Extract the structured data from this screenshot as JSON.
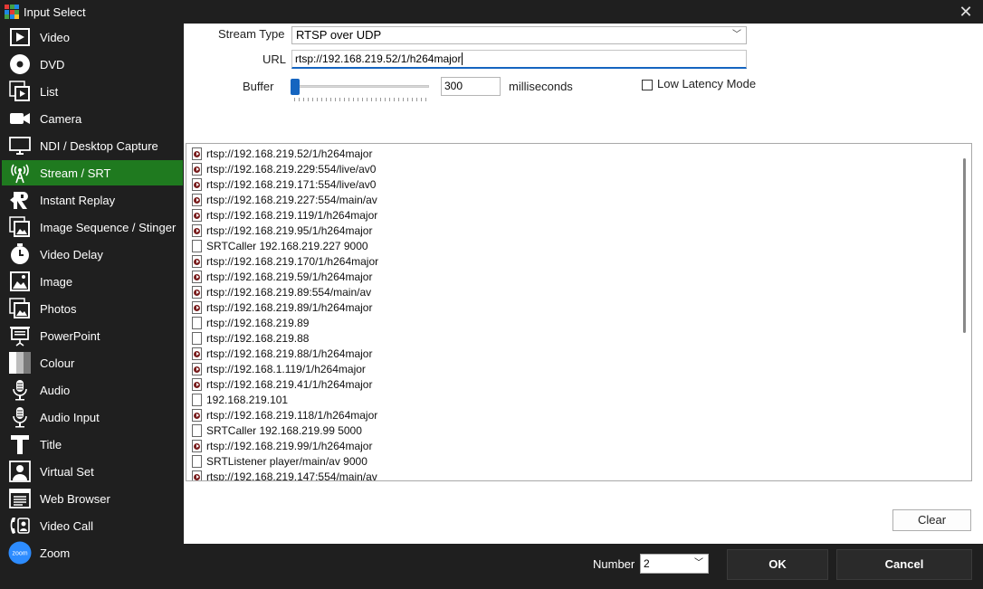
{
  "window": {
    "title": "Input Select",
    "logo_colors": [
      "#e53935",
      "#43a047",
      "#1e88e5",
      "#1e88e5",
      "#e53935",
      "#43a047",
      "#43a047",
      "#1e88e5",
      "#fbc02d"
    ]
  },
  "sidebar": {
    "items": [
      {
        "label": "Video",
        "icon": "video-icon"
      },
      {
        "label": "DVD",
        "icon": "dvd-icon"
      },
      {
        "label": "List",
        "icon": "list-icon"
      },
      {
        "label": "Camera",
        "icon": "camera-icon"
      },
      {
        "label": "NDI / Desktop Capture",
        "icon": "monitor-icon"
      },
      {
        "label": "Stream / SRT",
        "icon": "antenna-icon",
        "active": true
      },
      {
        "label": "Instant Replay",
        "icon": "replay-icon"
      },
      {
        "label": "Image Sequence / Stinger",
        "icon": "image-sequence-icon"
      },
      {
        "label": "Video Delay",
        "icon": "clock-icon"
      },
      {
        "label": "Image",
        "icon": "image-icon"
      },
      {
        "label": "Photos",
        "icon": "photos-icon"
      },
      {
        "label": "PowerPoint",
        "icon": "presentation-icon"
      },
      {
        "label": "Colour",
        "icon": "colour-bars-icon"
      },
      {
        "label": "Audio",
        "icon": "microphone-icon"
      },
      {
        "label": "Audio Input",
        "icon": "microphone-input-icon"
      },
      {
        "label": "Title",
        "icon": "title-t-icon"
      },
      {
        "label": "Virtual Set",
        "icon": "person-icon"
      },
      {
        "label": "Web Browser",
        "icon": "browser-icon"
      },
      {
        "label": "Video Call",
        "icon": "phone-icon"
      },
      {
        "label": "Zoom",
        "icon": "zoom-icon"
      }
    ],
    "active_color": "#1f7a1f"
  },
  "form": {
    "stream_type_label": "Stream Type",
    "stream_type_value": "RTSP over UDP",
    "url_label": "URL",
    "url_value": "rtsp://192.168.219.52/1/h264major",
    "buffer_label": "Buffer",
    "buffer_value": "300",
    "buffer_unit": "milliseconds",
    "low_latency_label": "Low Latency Mode",
    "low_latency_checked": false
  },
  "history": {
    "items": [
      {
        "text": "rtsp://192.168.219.52/1/h264major",
        "icon": "stream-file-icon"
      },
      {
        "text": "rtsp://192.168.219.229:554/live/av0",
        "icon": "stream-file-icon"
      },
      {
        "text": "rtsp://192.168.219.171:554/live/av0",
        "icon": "stream-file-icon"
      },
      {
        "text": "rtsp://192.168.219.227:554/main/av",
        "icon": "stream-file-icon"
      },
      {
        "text": "rtsp://192.168.219.119/1/h264major",
        "icon": "stream-file-icon"
      },
      {
        "text": "rtsp://192.168.219.95/1/h264major",
        "icon": "stream-file-icon"
      },
      {
        "text": "SRTCaller 192.168.219.227 9000",
        "icon": "blank-file-icon"
      },
      {
        "text": "rtsp://192.168.219.170/1/h264major",
        "icon": "stream-file-icon"
      },
      {
        "text": "rtsp://192.168.219.59/1/h264major",
        "icon": "stream-file-icon"
      },
      {
        "text": "rtsp://192.168.219.89:554/main/av",
        "icon": "stream-file-icon"
      },
      {
        "text": "rtsp://192.168.219.89/1/h264major",
        "icon": "stream-file-icon"
      },
      {
        "text": "rtsp://192.168.219.89",
        "icon": "blank-file-icon"
      },
      {
        "text": "rtsp://192.168.219.88",
        "icon": "blank-file-icon"
      },
      {
        "text": "rtsp://192.168.219.88/1/h264major",
        "icon": "stream-file-icon"
      },
      {
        "text": "rtsp://192.168.1.119/1/h264major",
        "icon": "stream-file-icon"
      },
      {
        "text": "rtsp://192.168.219.41/1/h264major",
        "icon": "stream-file-icon"
      },
      {
        "text": "192.168.219.101",
        "icon": "blank-file-icon"
      },
      {
        "text": "rtsp://192.168.219.118/1/h264major",
        "icon": "stream-file-icon"
      },
      {
        "text": "SRTCaller 192.168.219.99 5000",
        "icon": "blank-file-icon"
      },
      {
        "text": "rtsp://192.168.219.99/1/h264major",
        "icon": "stream-file-icon"
      },
      {
        "text": "SRTListener player/main/av 9000",
        "icon": "blank-file-icon"
      },
      {
        "text": "rtsp://192.168.219.147:554/main/av",
        "icon": "stream-file-icon"
      }
    ],
    "clear_label": "Clear"
  },
  "footer": {
    "number_label": "Number",
    "number_value": "2",
    "ok_label": "OK",
    "cancel_label": "Cancel"
  }
}
